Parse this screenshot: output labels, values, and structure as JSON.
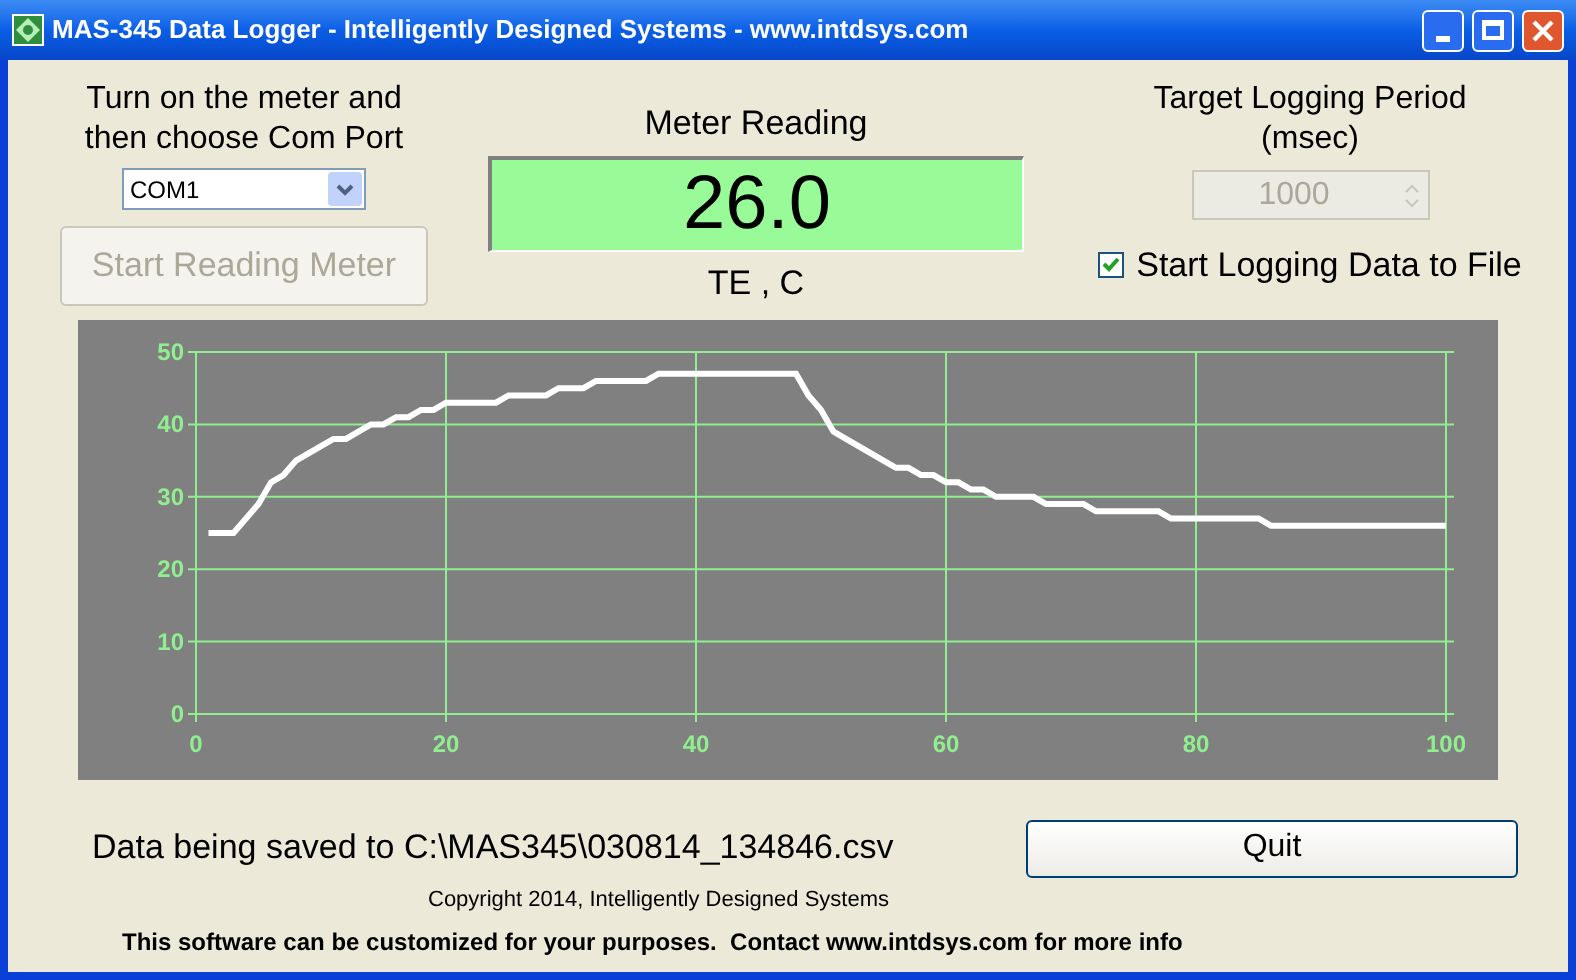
{
  "window": {
    "title": "MAS-345 Data Logger - Intelligently Designed Systems - www.intdsys.com"
  },
  "port": {
    "instruction": "Turn on the meter and then choose Com Port",
    "value": "COM1",
    "start_button": {
      "label": "Start Reading Meter",
      "disabled": true
    }
  },
  "meter": {
    "title": "Meter Reading",
    "value": "26.0",
    "unit": "TE , C"
  },
  "logging": {
    "title": "Target Logging Period (msec)",
    "period": "1000",
    "period_disabled": true,
    "checkbox": {
      "label": "Start Logging Data to File",
      "checked": true
    }
  },
  "chart": {
    "chart_data": {
      "type": "line",
      "x": [
        1,
        3,
        5,
        6,
        7,
        8,
        9,
        10,
        11,
        12,
        13,
        14,
        15,
        16,
        17,
        18,
        19,
        20,
        24,
        25,
        28,
        29,
        31,
        32,
        36,
        37,
        48,
        49,
        50,
        51,
        52,
        53,
        54,
        55,
        56,
        57,
        58,
        59,
        60,
        61,
        62,
        63,
        64,
        67,
        68,
        71,
        72,
        77,
        78,
        85,
        86,
        100
      ],
      "series": [
        {
          "color": "#ffffff",
          "values": [
            25,
            25,
            29,
            32,
            33,
            35,
            36,
            37,
            38,
            38,
            39,
            40,
            40,
            41,
            41,
            42,
            42,
            43,
            43,
            44,
            44,
            45,
            45,
            46,
            46,
            47,
            47,
            44,
            42,
            39,
            38,
            37,
            36,
            35,
            34,
            34,
            33,
            33,
            32,
            32,
            31,
            31,
            30,
            30,
            29,
            29,
            28,
            28,
            27,
            27,
            26,
            26
          ]
        }
      ],
      "xlim": [
        0,
        100
      ],
      "ylim": [
        0,
        50
      ],
      "xticks": [
        0,
        20,
        40,
        60,
        80,
        100
      ],
      "yticks": [
        0,
        10,
        20,
        30,
        40,
        50
      ],
      "grid": true
    }
  },
  "status": "Data being saved to C:\\MAS345\\030814_134846.csv",
  "quit_button": "Quit",
  "copyright": "Copyright 2014, Intelligently Designed Systems",
  "footer": "This software can be customized for your purposes.  Contact www.intdsys.com for more info"
}
